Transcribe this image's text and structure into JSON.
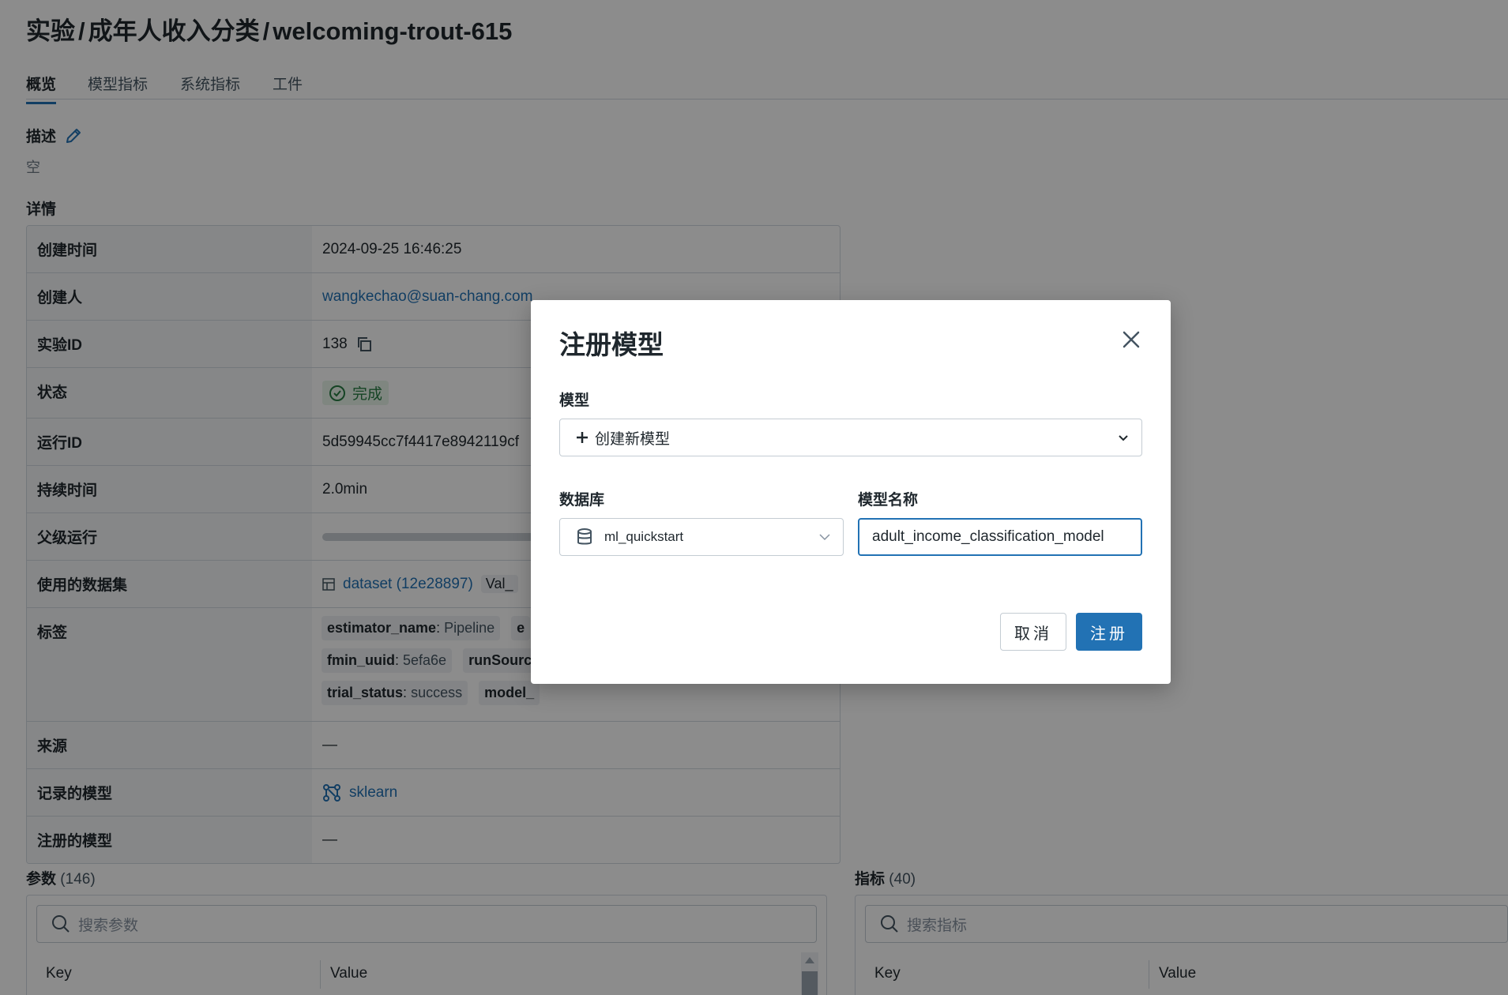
{
  "header": {
    "breadcrumb_1": "实验",
    "breadcrumb_2": "成年人收入分类",
    "run_name": "welcoming-trout-615",
    "separator": "/"
  },
  "tabs": [
    {
      "label": "概览",
      "active": true
    },
    {
      "label": "模型指标",
      "active": false
    },
    {
      "label": "系统指标",
      "active": false
    },
    {
      "label": "工件",
      "active": false
    }
  ],
  "description": {
    "heading": "描述",
    "value": "空"
  },
  "details": {
    "heading": "详情",
    "created_time": {
      "key": "创建时间",
      "value": "2024-09-25 16:46:25"
    },
    "creator": {
      "key": "创建人",
      "value": "wangkechao@suan-chang.com"
    },
    "experiment_id": {
      "key": "实验ID",
      "value": "138"
    },
    "status": {
      "key": "状态",
      "value": "完成"
    },
    "run_id": {
      "key": "运行ID",
      "value": "5d59945cc7f4417e8942119cf"
    },
    "duration": {
      "key": "持续时间",
      "value": "2.0min"
    },
    "parent_run": {
      "key": "父级运行"
    },
    "datasets": {
      "key": "使用的数据集",
      "value": "dataset (12e28897)",
      "tag": "Val_"
    },
    "tags": {
      "key": "标签",
      "items": [
        {
          "name": "estimator_name",
          "value": "Pipeline"
        },
        {
          "name": "e",
          "value": ""
        },
        {
          "name": "fmin_uuid",
          "value": "5efa6e"
        },
        {
          "name": "runSourc",
          "value": ""
        },
        {
          "name": "trial_status",
          "value": "success"
        },
        {
          "name": "model_",
          "value": ""
        }
      ]
    },
    "source": {
      "key": "来源",
      "value": "—"
    },
    "logged_models": {
      "key": "记录的模型",
      "value": "sklearn"
    },
    "registered_models": {
      "key": "注册的模型",
      "value": "—"
    }
  },
  "params": {
    "title": "参数",
    "count": "(146)",
    "search_placeholder": "搜索参数",
    "col_key": "Key",
    "col_value": "Value"
  },
  "metrics": {
    "title": "指标",
    "count": "(40)",
    "search_placeholder": "搜索指标",
    "col_key": "Key",
    "col_value": "Value"
  },
  "modal": {
    "title": "注册模型",
    "model_label": "模型",
    "model_select_value": "创建新模型",
    "database_label": "数据库",
    "database_value": "ml_quickstart",
    "model_name_label": "模型名称",
    "model_name_value": "adult_income_classification_model",
    "cancel_label": "取消",
    "register_label": "注册"
  },
  "colors": {
    "accent": "#2272b4",
    "success": "#277c43"
  }
}
